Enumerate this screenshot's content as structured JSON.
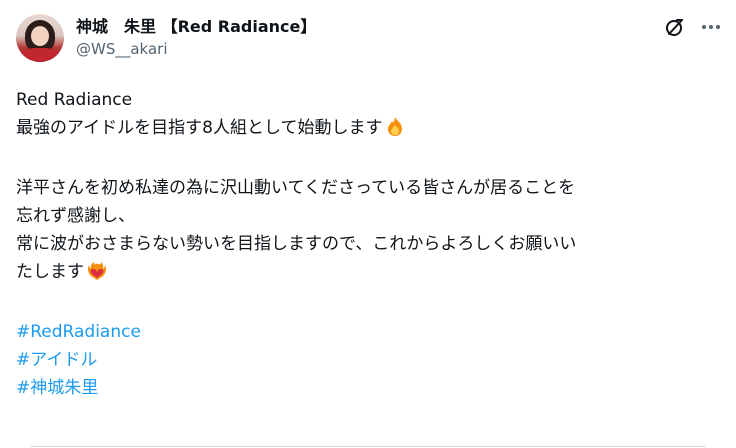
{
  "author": {
    "display_name": "神城　朱里 【Red Radiance】",
    "handle": "@WS__akari"
  },
  "icons": {
    "grok": "grok-icon",
    "more": "more-icon",
    "fire": "fire-emoji",
    "heart": "burning-heart-emoji"
  },
  "tweet": {
    "line1": "Red Radiance",
    "line2": "最強のアイドルを目指す8人組として始動します",
    "line3": "洋平さんを初め私達の為に沢山動いてくださっている皆さんが居ることを",
    "line4": "忘れず感謝し、",
    "line5": "常に波がおさまらない勢いを目指しますので、これからよろしくお願いい",
    "line6": "たします",
    "hashtags": [
      "#RedRadiance",
      "#アイドル",
      "#神城朱里"
    ]
  },
  "colors": {
    "text": "#0f1419",
    "secondary": "#536471",
    "link": "#1d9bf0"
  }
}
